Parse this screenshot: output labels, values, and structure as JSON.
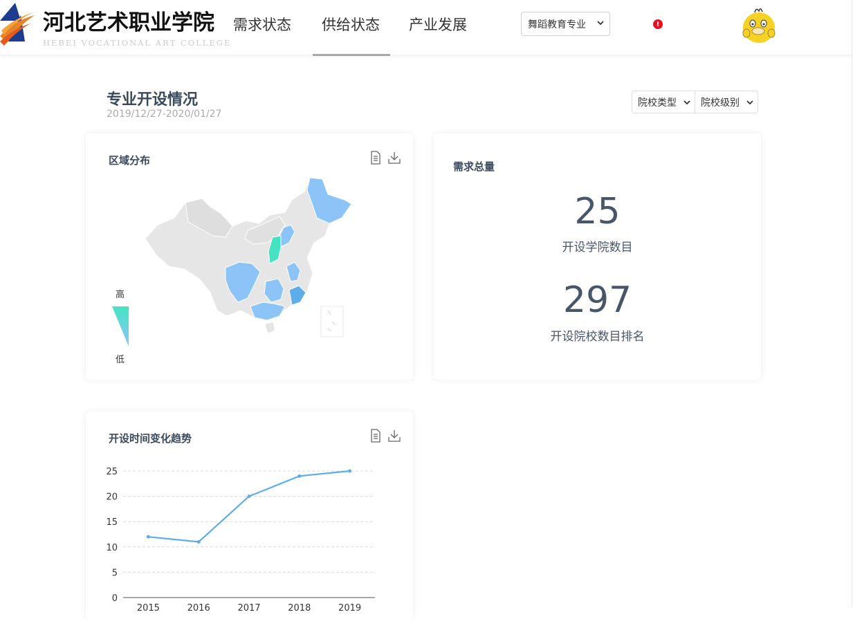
{
  "header": {
    "logo_text": "河北艺术职业学院",
    "logo_subtext": "HEBEI VOCATIONAL ART COLLEGE",
    "nav": [
      {
        "label": "需求状态"
      },
      {
        "label": "供给状态"
      },
      {
        "label": "产业发展"
      }
    ],
    "major_select": "舞蹈教育专业",
    "alert_glyph": "!"
  },
  "page": {
    "title": "专业开设情况",
    "date_range": "2019/12/27-2020/01/27",
    "filters": [
      {
        "label": "院校类型"
      },
      {
        "label": "院校级别"
      }
    ]
  },
  "region_card": {
    "title": "区域分布",
    "legend_high": "高",
    "legend_low": "低"
  },
  "total_card": {
    "title": "需求总量",
    "stat1_value": "25",
    "stat1_label": "开设学院数目",
    "stat2_value": "297",
    "stat2_label": "开设院校数目排名"
  },
  "trend_card": {
    "title": "开设时间变化趋势"
  },
  "colors": {
    "accent_line": "#5dade8",
    "map_high": "#46e3c3",
    "map_mid": "#8cc4f8",
    "map_base": "#e6e6e6"
  },
  "chart_data": {
    "type": "line",
    "x": [
      "2015",
      "2016",
      "2017",
      "2018",
      "2019"
    ],
    "series": [
      {
        "values": [
          12,
          11,
          20,
          24,
          25
        ]
      }
    ],
    "yticks": [
      0,
      5,
      10,
      15,
      20,
      25
    ],
    "ylim": [
      0,
      25
    ],
    "grid": true,
    "title": "",
    "xlabel": "",
    "ylabel": ""
  }
}
